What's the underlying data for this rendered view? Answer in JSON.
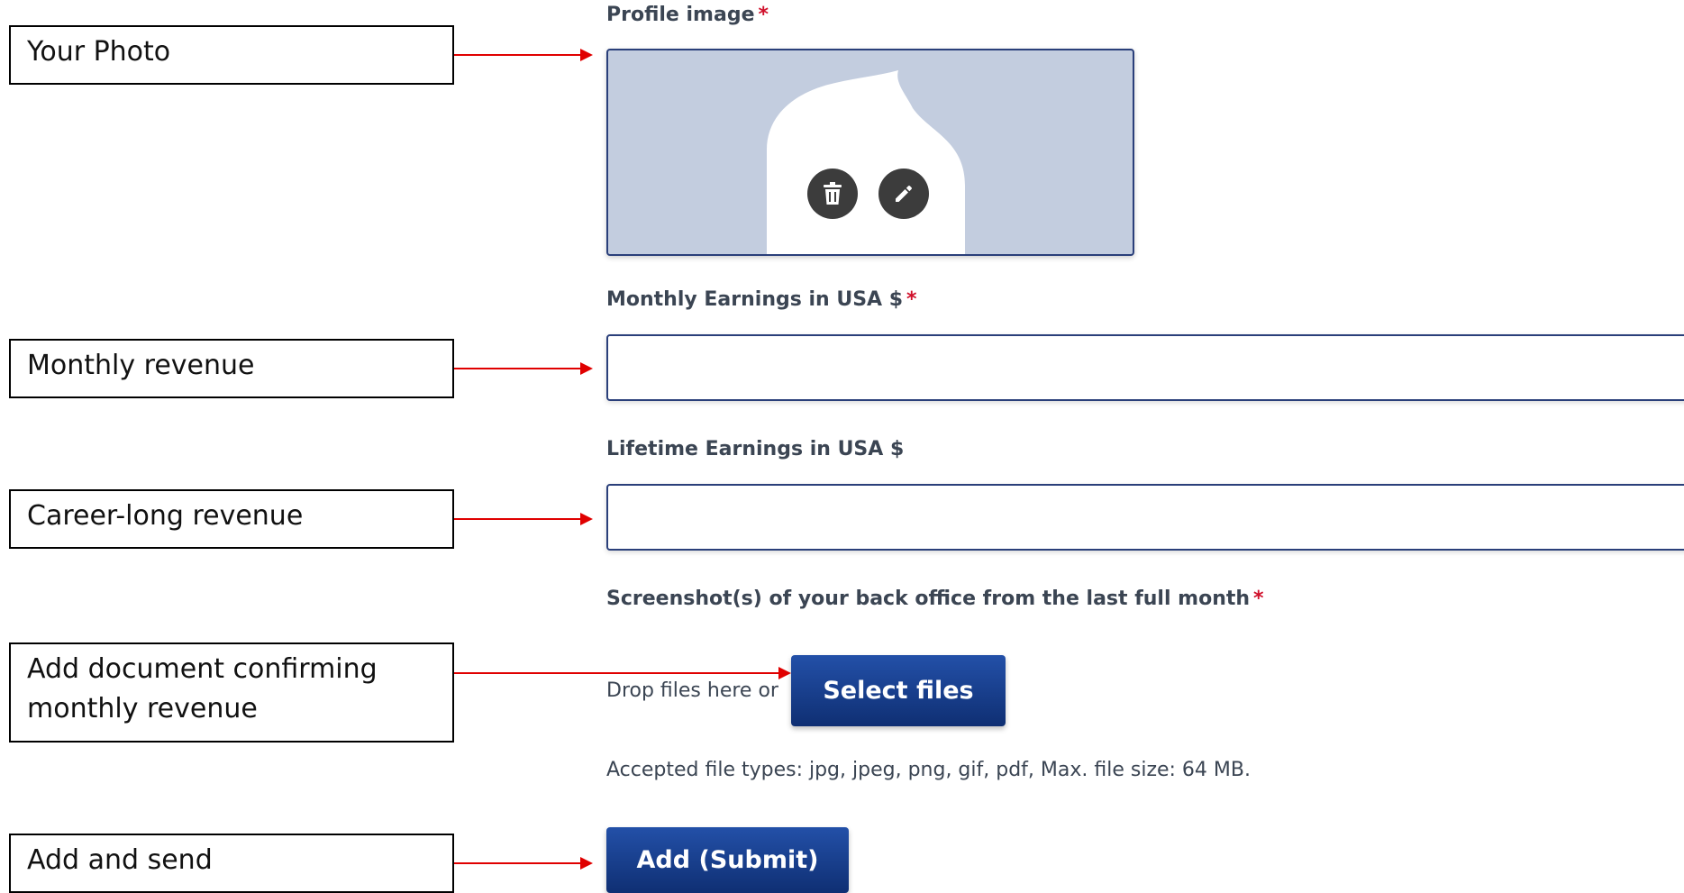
{
  "annotations": {
    "photo": "Your Photo",
    "monthly": "Monthly revenue",
    "lifetime": "Career-long revenue",
    "document_line1": "Add document confirming",
    "document_line2": "monthly revenue",
    "submit": "Add and send"
  },
  "form": {
    "profile_image": {
      "label": "Profile image",
      "required_mark": "*"
    },
    "monthly_earnings": {
      "label": "Monthly Earnings in USA $",
      "required_mark": "*",
      "value": ""
    },
    "lifetime_earnings": {
      "label": "Lifetime Earnings in USA $",
      "value": ""
    },
    "screenshots": {
      "label": "Screenshot(s) of your back office from the last full month",
      "required_mark": "*",
      "drop_text": "Drop files here or",
      "select_button": "Select files",
      "accepted_text": "Accepted file types: jpg, jpeg, png, gif, pdf, Max. file size: 64 MB."
    },
    "submit_button": "Add (Submit)"
  },
  "icons": {
    "delete": "trash-icon",
    "edit": "pencil-icon"
  },
  "colors": {
    "arrow": "#e00000",
    "button": "#1a3f8f",
    "required": "#d0102b",
    "photo_bg": "#c3cddf"
  }
}
